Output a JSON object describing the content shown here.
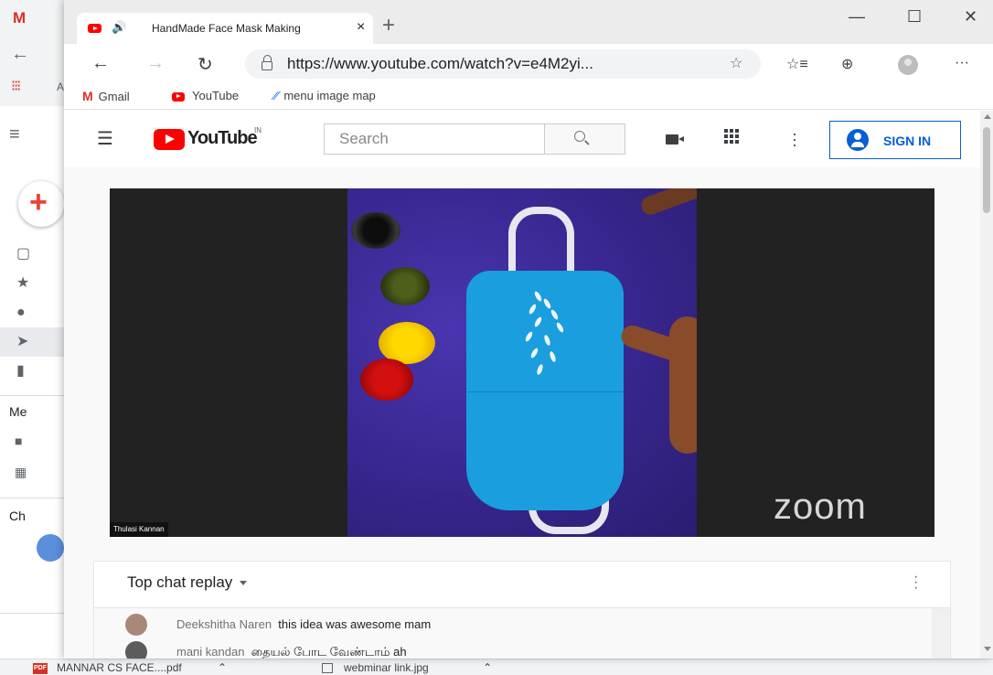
{
  "background_window": {
    "gmail_logo": "M",
    "apps_label": "A",
    "compose_glyph": "+",
    "section_meet": "Me",
    "section_chat": "Ch"
  },
  "browser": {
    "tab": {
      "title": "HandMade Face Mask Making",
      "audio_glyph": "🔊",
      "close_glyph": "×"
    },
    "new_tab_glyph": "+",
    "window_controls": {
      "minimize": "—",
      "maximize": "☐",
      "close": "✕"
    },
    "nav": {
      "back": "←",
      "forward": "→",
      "reload": "↻"
    },
    "address_bar": {
      "url": "https://www.youtube.com/watch?v=e4M2yi..."
    },
    "toolbar": {
      "favorite": "☆",
      "favorites": "☆≡",
      "collections": "⊕",
      "more": "···"
    },
    "bookmarks": [
      {
        "label": "Gmail",
        "icon": "gmail-icon"
      },
      {
        "label": "YouTube",
        "icon": "youtube-icon"
      },
      {
        "label": "menu image map",
        "icon": "map-icon"
      }
    ]
  },
  "youtube": {
    "logo_text": "YouTube",
    "region": "IN",
    "search_placeholder": "Search",
    "sign_in_label": "SIGN IN",
    "video": {
      "watermark": "zoom",
      "speaker_name": "Thulasi Kannan"
    },
    "chat": {
      "title": "Top chat replay",
      "messages": [
        {
          "author": "Deekshitha Naren",
          "text": "this idea was awesome mam",
          "avatar_color": "#a88878"
        },
        {
          "author": "mani kandan",
          "text": "தையல் போட வேண்டாம் ah",
          "avatar_color": "#5c5c5c"
        }
      ]
    }
  },
  "downloads": [
    {
      "name": "MANNAR CS FACE....pdf",
      "type": "pdf"
    },
    {
      "name": "webminar link.jpg",
      "type": "image"
    }
  ],
  "colors": {
    "youtube_red": "#ff0000",
    "sign_in_blue": "#065fd4",
    "mask_blue": "#1a9ede",
    "cloth_purple": "#3c2c9c"
  }
}
